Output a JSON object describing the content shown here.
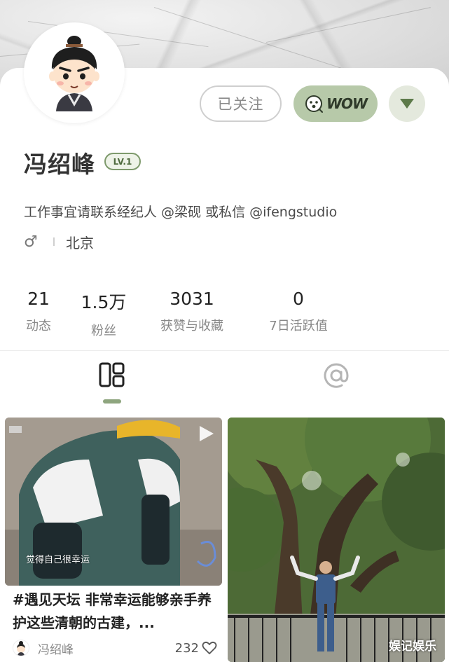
{
  "profile": {
    "name": "冯绍峰",
    "level": "LV.1",
    "bio": "工作事宜请联系经纪人 @梁砚 或私信 @ifengstudio",
    "gender_symbol": "♂",
    "city": "北京",
    "avatar_icon": "cartoon-avatar-icon"
  },
  "actions": {
    "follow_label": "已关注",
    "wow_label": "WOW",
    "more_icon": "triangle-down-icon"
  },
  "stats": [
    {
      "value": "21",
      "label": "动态"
    },
    {
      "value": "1.5万",
      "label": "粉丝"
    },
    {
      "value": "3031",
      "label": "获赞与收藏"
    },
    {
      "value": "0",
      "label": "7日活跃值"
    }
  ],
  "tabs": [
    {
      "icon": "grid-icon",
      "active": true
    },
    {
      "icon": "at-icon",
      "active": false
    }
  ],
  "posts": [
    {
      "caption": "觉得自己很幸运",
      "title": "#遇见天坛 非常幸运能够亲手养护这些清朝的古建，...",
      "author": "冯绍峰",
      "likes": "232",
      "type": "video"
    },
    {
      "type": "image"
    }
  ],
  "watermark": "娱记娱乐",
  "colors": {
    "accent_green": "#8ea57e",
    "wow_bg": "#b7c9a9",
    "level_border": "#7e9a6c"
  }
}
